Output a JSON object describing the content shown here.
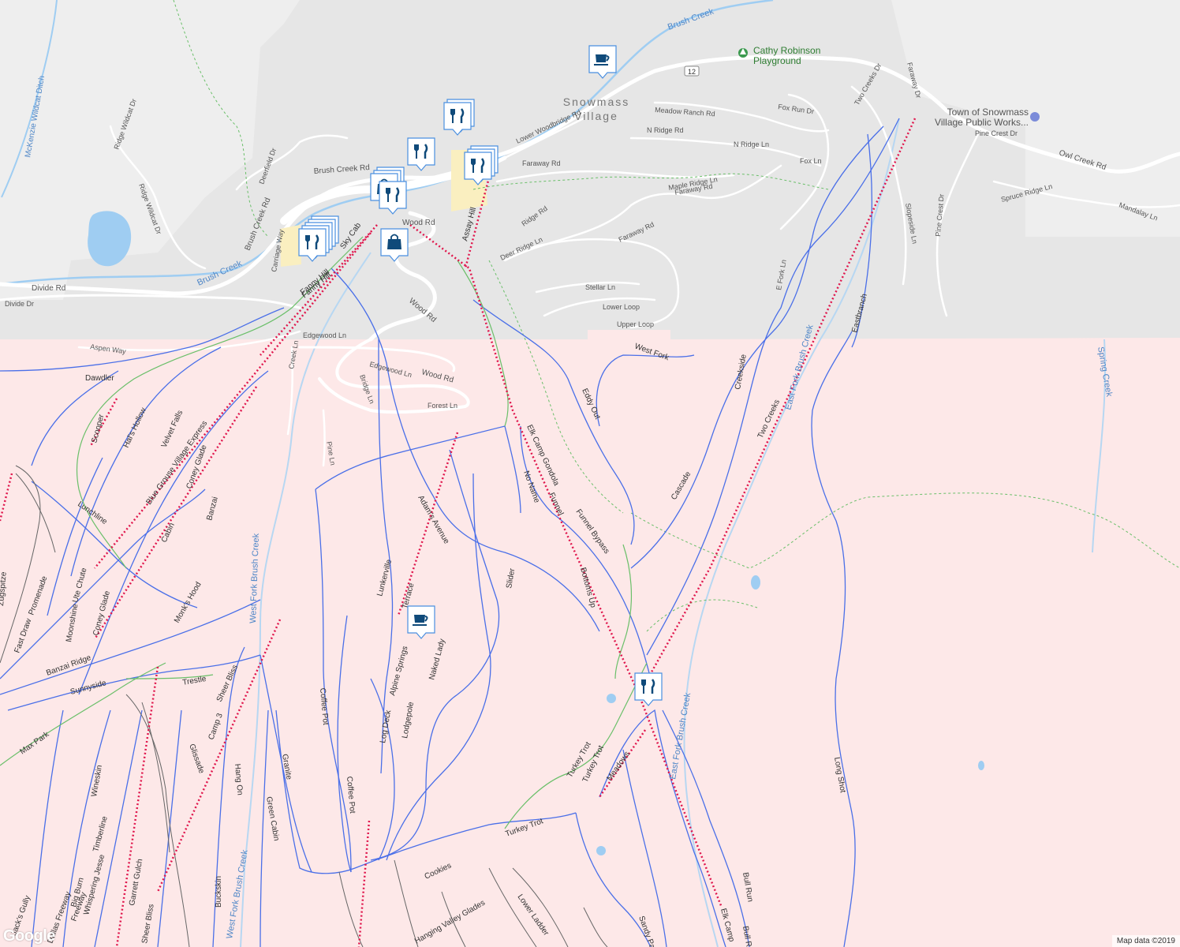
{
  "colors": {
    "base": "#eeeeee",
    "ski_area": "#fde8e8",
    "water": "#9fcdf2",
    "trail_line": "#4a6fe8",
    "trail_line_expert": "#666666",
    "lift_line": "#e0174d",
    "footpath": "#6abf69",
    "road": "#ffffff",
    "label_dark": "#444444",
    "label_water": "#4e86c7",
    "poi_marker": "#0f4a7a",
    "park_label": "#2e7d32"
  },
  "places": [
    {
      "key": "snowmass",
      "text": "Snowmass",
      "text2": "Village"
    },
    {
      "key": "cathy",
      "text": "Cathy Robinson",
      "text2": "Playground"
    },
    {
      "key": "town",
      "text": "Town of Snowmass",
      "text2": "Village Public Works..."
    }
  ],
  "roads": [
    "Brush Creek Rd",
    "Brush Creek Rd",
    "Owl Creek Rd",
    "Divide Rd",
    "Divide Dr",
    "Meadow Ranch Rd",
    "Fox Run Dr",
    "N Ridge Rd",
    "N Ridge Ln",
    "Fox Ln",
    "Faraway Rd",
    "Faraway Rd",
    "Faraway Rd",
    "Maple Ridge Ln",
    "Ridge Rd",
    "Deer Ridge Ln",
    "Stellar Ln",
    "Lower Loop",
    "Upper Loop",
    "Wood Rd",
    "Wood Rd",
    "Wood Rd",
    "Edgewood Ln",
    "Edgewood Ln",
    "Aspen Way",
    "Creek Ln",
    "Bridge Ln",
    "Forest Ln",
    "Pine Ln",
    "Deerfield Dr",
    "Ridge Wildcat Dr",
    "Ridge Wildcat Dr",
    "Carriage Way",
    "Lower Woodbridge Rd",
    "Two Creeks Dr",
    "Faraway Dr",
    "Pine Crest Dr",
    "Spruce Ridge Ln",
    "Slopeside Ln",
    "Mandalay Ln",
    "Pine Crest Dr",
    "E Fork Ln",
    "Assay Hill",
    "Fanny Hill",
    "12"
  ],
  "water_labels": [
    "Brush Creek",
    "Brush Creek",
    "McKenzie Wildcat Ditch",
    "West Fork Brush Creek",
    "West Fork Brush Creek",
    "East Fork Brush Creek",
    "East Fork Brush Creek",
    "Spring Creek"
  ],
  "trails": [
    "Dawdler",
    "Scooper",
    "Hal's Hollow",
    "Velvet Falls",
    "Blue Grouse Village Express",
    "Lunchline",
    "Cabin",
    "Coney Glade",
    "Banzai",
    "Ute Chute",
    "Moonshine",
    "Coney Glade",
    "Promenade",
    "Fast Draw",
    "Zugspitze",
    "Banzai Ridge",
    "Monk's Hood",
    "Sunnyside",
    "Trestle",
    "Sheer Bliss",
    "Max Park",
    "Camp 3",
    "Glissade",
    "Hang On",
    "Granite",
    "Green Cabin",
    "Wineskin",
    "Timberline",
    "Garrett Gulch",
    "Whispering Jesse",
    "Big Burn",
    "Freeway",
    "Dallas Freeway",
    "Sheer Bliss",
    "Buckskin",
    "Coffee Pot",
    "Coffee Pot",
    "Log Deck",
    "Lodgepole",
    "Alpine Springs",
    "Turkey Trot",
    "Lunkerville",
    "Adam's Avenue",
    "Naked Lady",
    "Slider",
    "Elk Camp Gondola",
    "No Name",
    "Funnel",
    "Funnel Bypass",
    "Bottoms Up",
    "Eddy Out",
    "Cascade",
    "Two Creeks",
    "Creekside",
    "Eastbranch",
    "West Fork",
    "Turkey Trot",
    "Meadows",
    "Turkey Trot",
    "Cookies",
    "Hanging Valley Glades",
    "Lower Ladder",
    "Sandy Park",
    "Long Shot",
    "Bull Run",
    "Bull Run",
    "Elk Camp",
    "Sky Cab",
    "Fanny Hill",
    "Jack's Gully",
    "Terrace"
  ],
  "pois": [
    {
      "type": "cafe",
      "icon": "coffee-cup-icon"
    },
    {
      "type": "restaurant",
      "icon": "fork-knife-icon"
    },
    {
      "type": "restaurant",
      "icon": "fork-knife-icon"
    },
    {
      "type": "restaurant",
      "icon": "fork-knife-icon"
    },
    {
      "type": "shopping",
      "icon": "shopping-bag-icon"
    },
    {
      "type": "restaurant",
      "icon": "fork-knife-icon"
    },
    {
      "type": "shopping",
      "icon": "shopping-bag-icon"
    },
    {
      "type": "restaurant-group",
      "icon": "fork-knife-icon"
    },
    {
      "type": "cafe",
      "icon": "coffee-cup-icon"
    },
    {
      "type": "restaurant",
      "icon": "fork-knife-icon"
    }
  ],
  "footer": {
    "logo": "Google",
    "credit": "Map data ©2019"
  }
}
